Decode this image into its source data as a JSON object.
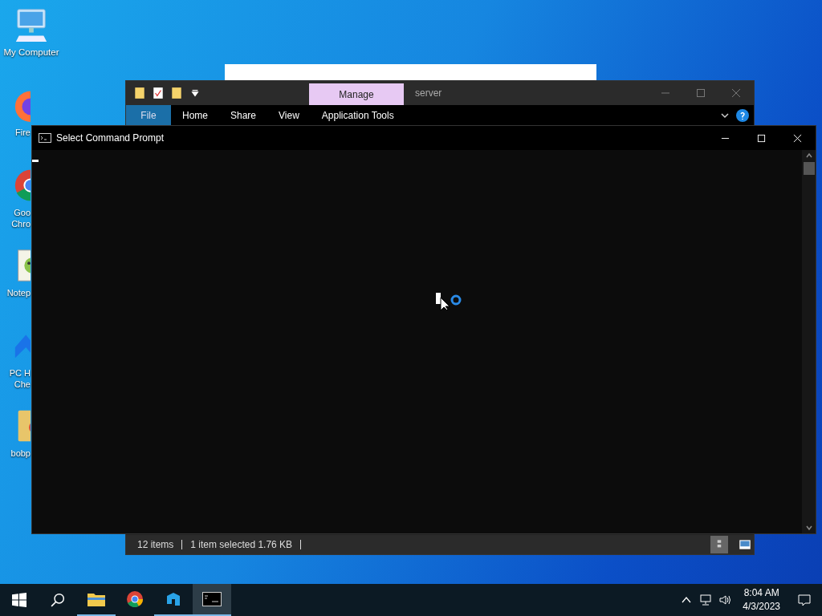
{
  "desktop_icons": [
    {
      "kind": "computer",
      "lines": [
        "My Computer"
      ]
    },
    {
      "kind": "firefox",
      "lines": [
        "Fire"
      ]
    },
    {
      "kind": "chrome",
      "lines": [
        "Goo",
        "Chro"
      ]
    },
    {
      "kind": "notepad",
      "lines": [
        "Notep"
      ]
    },
    {
      "kind": "health",
      "lines": [
        "PC H",
        "Che"
      ]
    },
    {
      "kind": "folder",
      "lines": [
        "bobp"
      ]
    }
  ],
  "explorer": {
    "title": "server",
    "context_tab": "Manage",
    "ribbon_tabs": [
      {
        "label": "File",
        "selected": true
      },
      {
        "label": "Home",
        "selected": false
      },
      {
        "label": "Share",
        "selected": false
      },
      {
        "label": "View",
        "selected": false
      },
      {
        "label": "Application Tools",
        "selected": false
      }
    ],
    "status_bar": [
      "12 items",
      "1 item selected  1.76 KB"
    ]
  },
  "console": {
    "title": "Select Command Prompt"
  },
  "taskbar": {
    "apps": [
      {
        "kind": "explorer",
        "running": true,
        "selected": false
      },
      {
        "kind": "chrome",
        "running": false,
        "selected": false
      },
      {
        "kind": "app",
        "running": true,
        "selected": false
      },
      {
        "kind": "console",
        "running": true,
        "selected": true
      }
    ],
    "time": "8:04 AM",
    "date": "4/3/2023"
  }
}
